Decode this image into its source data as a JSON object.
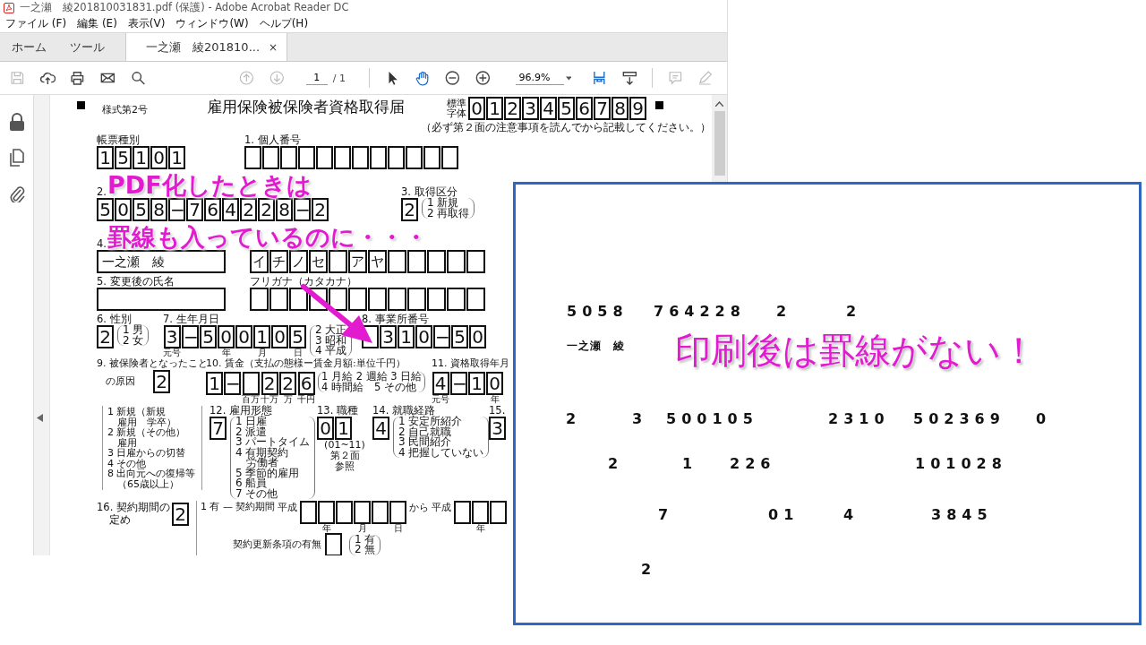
{
  "window": {
    "title": "一之瀬　綾201810031831.pdf (保護) - Adobe Acrobat Reader DC"
  },
  "menu": [
    "ファイル (F)",
    "編集 (E)",
    "表示(V)",
    "ウィンドウ(W)",
    "ヘルプ(H)"
  ],
  "tabs": [
    {
      "label": "ホーム",
      "selected": false
    },
    {
      "label": "ツール",
      "selected": false
    },
    {
      "label": "一之瀬　綾201810...",
      "selected": true,
      "close": "×"
    }
  ],
  "toolbar": {
    "page": "1",
    "page_count": "/ 1",
    "zoom": "96.9%"
  },
  "form": {
    "form_no": "様式第2号",
    "title": "雇用保険被保険者資格取得届",
    "standard_label": [
      "標準",
      "字体"
    ],
    "standard_digits": [
      "0",
      "1",
      "2",
      "3",
      "4",
      "5",
      "6",
      "7",
      "8",
      "9"
    ],
    "note": "（必ず第２面の注意事項を読んでから記載してください。）",
    "slip_type": {
      "label": "帳票種別",
      "boxes": [
        "1",
        "5",
        "1",
        "0",
        "1"
      ]
    },
    "personal_number": {
      "label": "1. 個人番号",
      "boxes": [
        {
          "kind": "blank"
        },
        {
          "kind": "blank"
        },
        {
          "kind": "blank"
        },
        {
          "kind": "blank"
        },
        {
          "kind": "blank"
        },
        {
          "kind": "blank"
        },
        {
          "kind": "blank"
        },
        {
          "kind": "blank"
        },
        {
          "kind": "blank"
        },
        {
          "kind": "blank"
        },
        {
          "kind": "blank"
        },
        {
          "kind": "blank"
        }
      ]
    },
    "insured_number": {
      "label": "2.",
      "boxes": [
        "5",
        "0",
        "5",
        "8",
        "−",
        "7",
        "6",
        "4",
        "2",
        "2",
        "8",
        "−",
        "2"
      ]
    },
    "acquisition_type": {
      "label": "3. 取得区分",
      "boxes": [
        "2"
      ],
      "options": [
        "1 新規",
        "2 再取得"
      ]
    },
    "name": {
      "label": "4.",
      "value": "一之瀬　綾",
      "kana_boxes": [
        "イ",
        "チ",
        "ノ",
        "セ",
        {
          "kind": "blank"
        },
        "ア",
        "ヤ",
        {
          "kind": "blank"
        },
        {
          "kind": "blank"
        },
        {
          "kind": "blank"
        },
        {
          "kind": "blank"
        },
        {
          "kind": "blank"
        }
      ]
    },
    "new_name": {
      "label": "5. 変更後の氏名",
      "kana_label": "フリガナ（カタカナ）",
      "kana_boxes": [
        {
          "kind": "blank"
        },
        {
          "kind": "blank"
        },
        {
          "kind": "blank"
        },
        {
          "kind": "blank"
        },
        {
          "kind": "blank"
        },
        {
          "kind": "blank"
        },
        {
          "kind": "blank"
        },
        {
          "kind": "blank"
        },
        {
          "kind": "blank"
        },
        {
          "kind": "blank"
        },
        {
          "kind": "blank"
        },
        {
          "kind": "blank"
        }
      ]
    },
    "sex": {
      "label": "6. 性別",
      "boxes": [
        "2"
      ],
      "options": [
        "1 男",
        "2 女"
      ]
    },
    "birth": {
      "label": "7. 生年月日",
      "boxes": [
        {
          "digit": "3",
          "caption": "元号"
        },
        "−",
        "5",
        {
          "digit": "0",
          "caption": "年"
        },
        "0",
        {
          "digit": "1",
          "caption": "月"
        },
        "0",
        {
          "digit": "5",
          "caption": "日"
        }
      ],
      "options": [
        "2 大正",
        "3 昭和",
        "4 平成"
      ]
    },
    "office_number": {
      "label": "8. 事業所番号",
      "boxes": [
        {
          "kind": "blank"
        },
        "3",
        "1",
        "0",
        "−",
        "5",
        "0"
      ]
    },
    "cause": {
      "label": [
        "9. 被保険者となったこと",
        "の原因"
      ],
      "boxes": [
        "2"
      ],
      "options": [
        "1 新規（新規",
        "　雇用　学卒）",
        "2 新規（その他）",
        "　雇用",
        "3 日雇からの切替",
        "4 その他",
        "8 出向元への復帰等",
        "　（65歳以上）"
      ]
    },
    "wage": {
      "label": "10. 賃金（支払の態様ー賃金月額:単位千円）",
      "boxes": [
        "1",
        "−",
        {
          "kind": "blank",
          "caption": "百万"
        },
        {
          "digit": "2",
          "caption": "十万"
        },
        {
          "digit": "2",
          "caption": "万"
        },
        {
          "digit": "6",
          "caption": "千円"
        }
      ],
      "options": [
        "1 月給 2 週給 3 日給",
        "4 時間給　5 その他"
      ]
    },
    "acquired": {
      "label": "11. 資格取得年月",
      "boxes": [
        {
          "digit": "4",
          "caption": "元号"
        },
        "−",
        "1",
        {
          "digit": "0",
          "caption": "年"
        }
      ]
    },
    "employment": {
      "label": "12. 雇用形態",
      "boxes": [
        "7"
      ],
      "options": [
        "1 日雇",
        "2 派遣",
        "3 パートタイム",
        "4 有期契約",
        "　労働者",
        "5 季節的雇用",
        "6 船員",
        "7 その他"
      ]
    },
    "occupation": {
      "label": "13. 職種",
      "boxes": [
        "0",
        "1"
      ],
      "note": [
        "(01~11)",
        "第２面",
        "参照"
      ]
    },
    "route": {
      "label": "14. 就職経路",
      "boxes": [
        "4"
      ],
      "options": [
        "1 安定所紹介",
        "2 自己就職",
        "3 民間紹介",
        "4 把握していない"
      ]
    },
    "item15": {
      "label": "15.",
      "boxes": [
        "3"
      ]
    },
    "contract": {
      "label": [
        "16. 契約期間の",
        "定め"
      ],
      "boxes": [
        "2"
      ],
      "yes": "1 有 —",
      "period_label": "契約期間",
      "era": "平成",
      "from_boxes": [
        {
          "kind": "blank"
        },
        {
          "kind": "blank",
          "caption": "年"
        },
        {
          "kind": "blank"
        },
        {
          "kind": "blank",
          "caption": "月"
        },
        {
          "kind": "blank"
        },
        {
          "kind": "blank",
          "caption": "日"
        }
      ],
      "from": "から",
      "era2": "平成",
      "to_boxes": [
        {
          "kind": "blank"
        },
        {
          "kind": "blank",
          "caption": "年"
        },
        {
          "kind": "blank"
        }
      ],
      "renewal_label": "契約更新条項の有無",
      "renewal_boxes": [
        {
          "kind": "blank"
        }
      ],
      "renewal_options": [
        "1 有",
        "2 無"
      ]
    }
  },
  "callout": [
    "PDF化したときは",
    "罫線も入っているのに・・・"
  ],
  "print_preview": {
    "lines": [
      [
        "5058",
        "764228",
        "2",
        "2"
      ],
      [
        "一之瀬　綾"
      ],
      [
        "2",
        "3",
        "500105",
        "2310",
        "502369",
        "0"
      ],
      [
        "2",
        "1",
        "226",
        "101028"
      ],
      [
        "7",
        "01",
        "4",
        "3845"
      ],
      [
        "2"
      ]
    ],
    "caption": "印刷後は罫線がない！"
  }
}
